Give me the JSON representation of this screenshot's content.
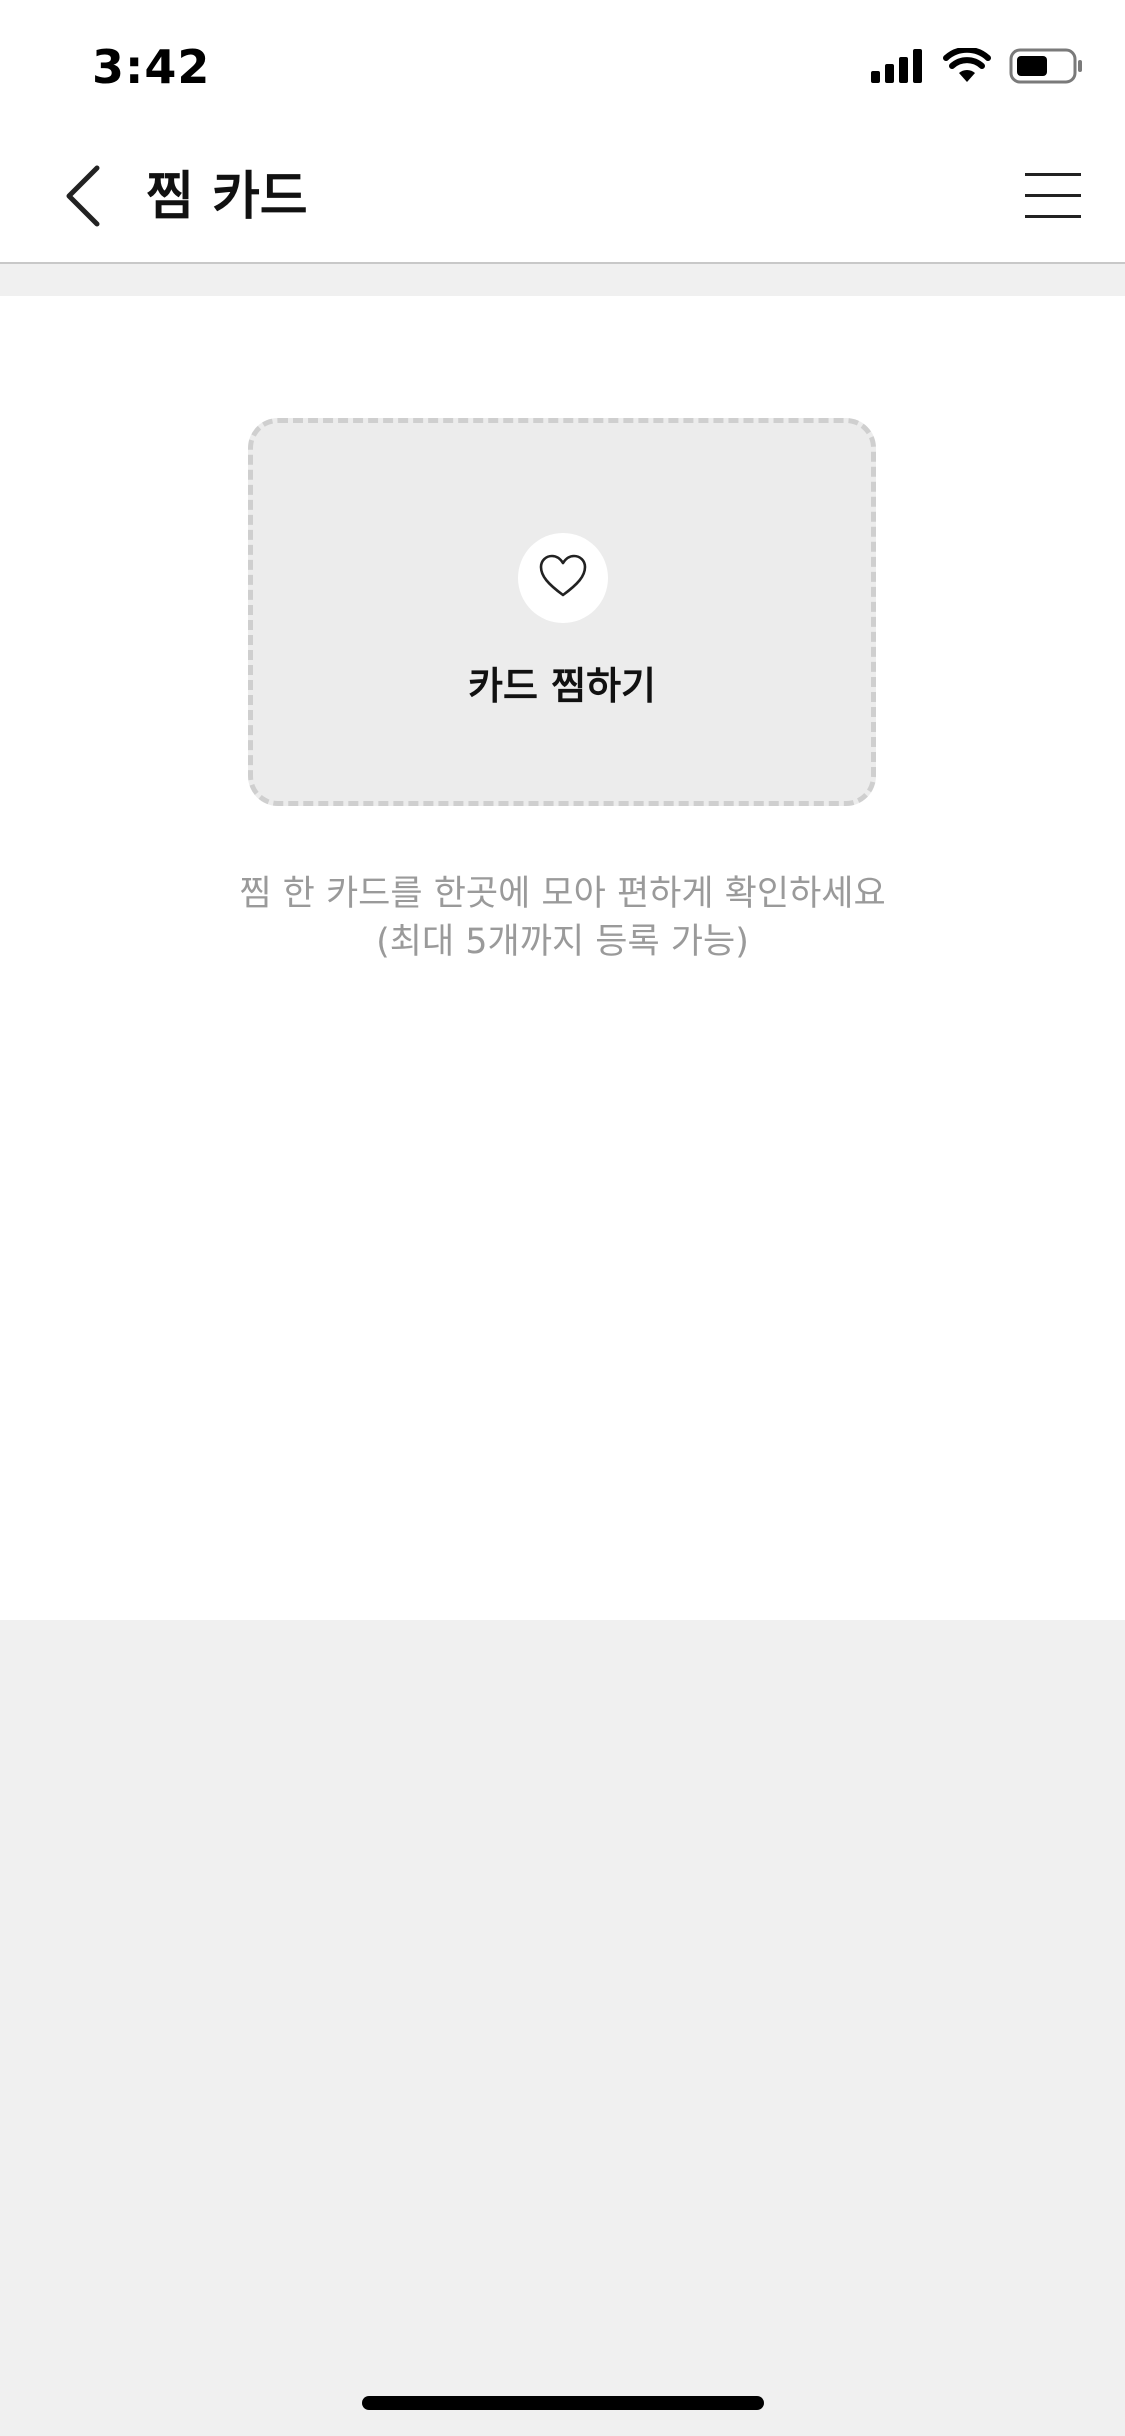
{
  "status_bar": {
    "time": "3:42",
    "icons": [
      "cellular-signal-icon",
      "wifi-icon",
      "battery-icon"
    ]
  },
  "nav": {
    "back_icon": "chevron-left-icon",
    "title": "찜 카드",
    "menu_icon": "hamburger-menu-icon"
  },
  "add_card": {
    "icon": "heart-outline-icon",
    "label": "카드 찜하기"
  },
  "helper": {
    "line1": "찜 한 카드를 한곳에 모아 편하게 확인하세요",
    "line2": "(최대 5개까지 등록 가능)"
  },
  "colors": {
    "background": "#f0f0f0",
    "card_fill": "#ececec",
    "card_border": "#cfcfcf",
    "helper_text": "#9a9a9a"
  }
}
